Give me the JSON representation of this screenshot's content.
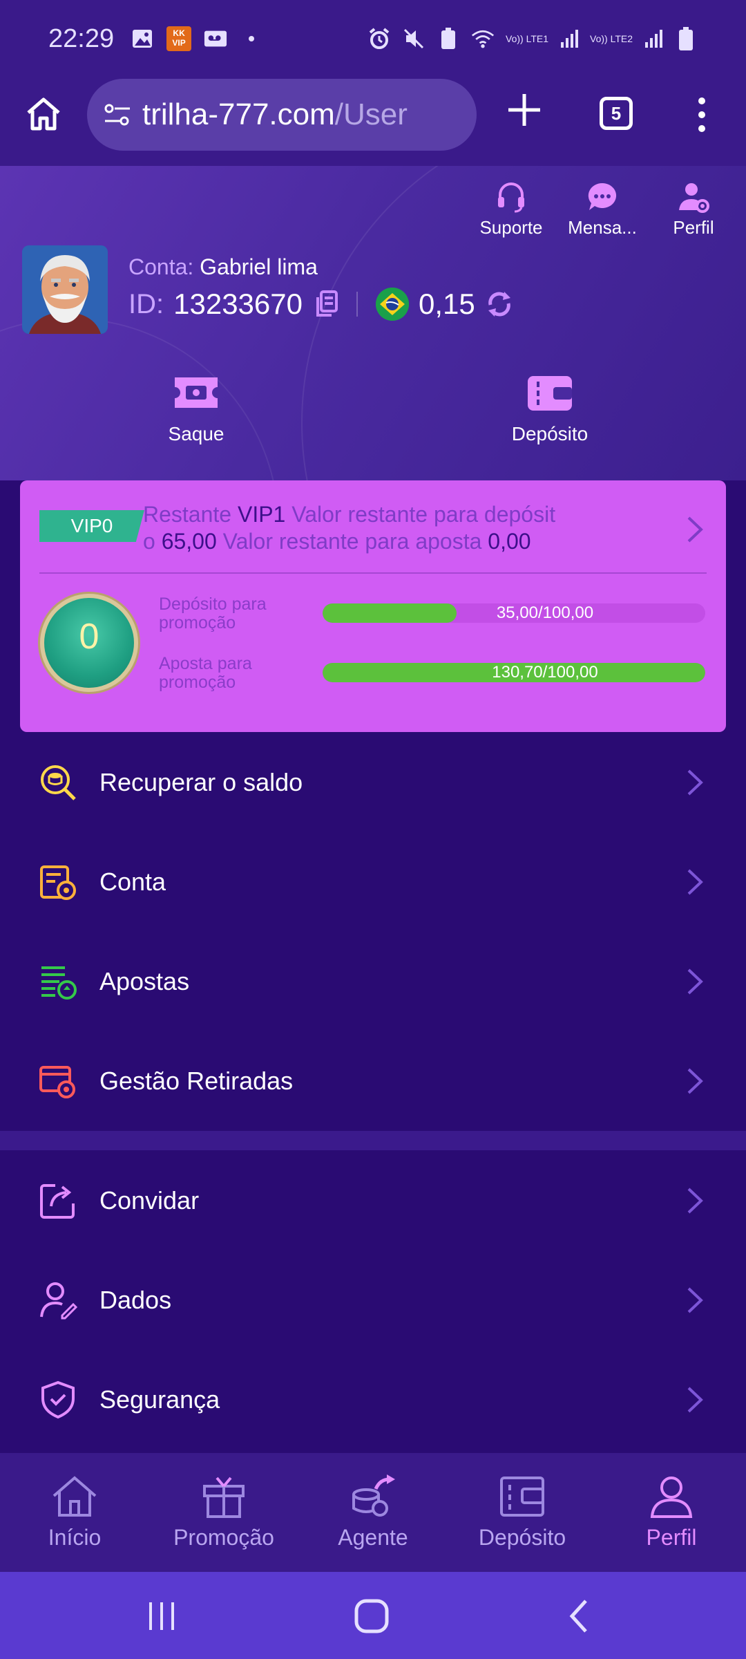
{
  "status_bar": {
    "time": "22:29",
    "kk_badge": "KK VIP",
    "lte1": "Vo)) LTE1",
    "lte2": "Vo)) LTE2"
  },
  "browser": {
    "url_host": "trilha-777.com",
    "url_path": "/User",
    "tab_count": "5"
  },
  "header": {
    "actions": [
      {
        "label": "Suporte",
        "icon": "headset-icon"
      },
      {
        "label": "Mensa...",
        "icon": "message-icon"
      },
      {
        "label": "Perfil",
        "icon": "user-settings-icon"
      }
    ],
    "account_label": "Conta:",
    "account_name": "Gabriel lima",
    "id_label": "ID:",
    "id_value": "13233670",
    "balance": "0,15",
    "saque_label": "Saque",
    "deposito_label": "Depósito"
  },
  "vip": {
    "badge": "VIP0",
    "line_prefix": "Restante",
    "next_level": "VIP1",
    "deposit_text": "Valor restante para depósit",
    "deposit_text_cont": "o",
    "deposit_remaining": "65,00",
    "bet_text": "Valor restante para aposta",
    "bet_remaining": "0,00",
    "level": "0",
    "deposit_progress_label": "Depósito para promoção",
    "deposit_progress_text": "35,00/100,00",
    "deposit_progress": 0.35,
    "bet_progress_label": "Aposta para promoção",
    "bet_progress_text": "130,70/100,00",
    "bet_progress": 1.0
  },
  "menu": {
    "group1": [
      {
        "label": "Recuperar o saldo",
        "icon": "coin-search-icon"
      },
      {
        "label": "Conta",
        "icon": "account-statement-icon"
      },
      {
        "label": "Apostas",
        "icon": "bets-list-icon"
      },
      {
        "label": "Gestão Retiradas",
        "icon": "withdraw-settings-icon"
      }
    ],
    "group2": [
      {
        "label": "Convidar",
        "icon": "share-icon"
      },
      {
        "label": "Dados",
        "icon": "user-edit-icon"
      },
      {
        "label": "Segurança",
        "icon": "shield-check-icon"
      }
    ]
  },
  "bottom_nav": [
    {
      "label": "Início",
      "icon": "home-icon"
    },
    {
      "label": "Promoção",
      "icon": "gift-icon"
    },
    {
      "label": "Agente",
      "icon": "agent-icon"
    },
    {
      "label": "Depósito",
      "icon": "wallet-icon"
    },
    {
      "label": "Perfil",
      "icon": "person-icon"
    }
  ],
  "colors": {
    "background": "#2a0b73",
    "vip_card": "#d05cf4",
    "accent": "#e38cff",
    "progress": "#5cc13c"
  }
}
